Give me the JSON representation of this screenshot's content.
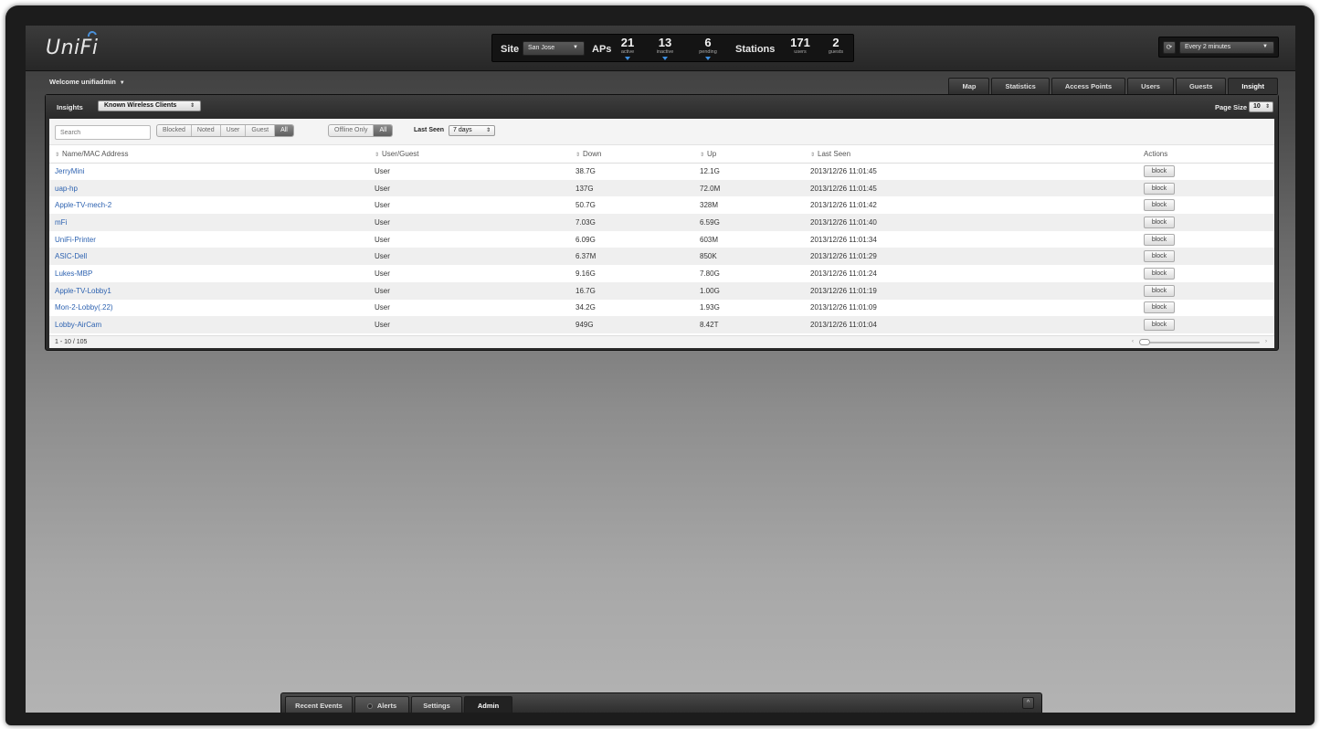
{
  "app": {
    "logo": "UniFi"
  },
  "header": {
    "site_label": "Site",
    "site_value": "San Jose",
    "aps_label": "APs",
    "aps": [
      {
        "num": "21",
        "sub": "active"
      },
      {
        "num": "13",
        "sub": "inactive"
      },
      {
        "num": "6",
        "sub": "pending"
      }
    ],
    "stations_label": "Stations",
    "stations": [
      {
        "num": "171",
        "sub": "users"
      },
      {
        "num": "2",
        "sub": "guests"
      }
    ],
    "refresh_value": "Every 2 minutes"
  },
  "welcome": "Welcome unifiadmin",
  "tabs": [
    "Map",
    "Statistics",
    "Access Points",
    "Users",
    "Guests",
    "Insight"
  ],
  "active_tab": "Insight",
  "insights": {
    "label": "Insights",
    "select_value": "Known Wireless Clients",
    "page_size_label": "Page Size",
    "page_size_value": "10"
  },
  "filters": {
    "search_placeholder": "Search",
    "type_buttons": [
      "Blocked",
      "Noted",
      "User",
      "Guest",
      "All"
    ],
    "type_active": "All",
    "offline_buttons": [
      "Offline Only",
      "All"
    ],
    "offline_active": "All",
    "last_seen_label": "Last Seen",
    "last_seen_value": "7 days"
  },
  "table": {
    "headers": [
      "Name/MAC Address",
      "User/Guest",
      "Down",
      "Up",
      "Last Seen",
      "Actions"
    ],
    "rows": [
      [
        "JerryMini",
        "User",
        "38.7G",
        "12.1G",
        "2013/12/26 11:01:45",
        "block"
      ],
      [
        "uap-hp",
        "User",
        "137G",
        "72.0M",
        "2013/12/26 11:01:45",
        "block"
      ],
      [
        "Apple-TV-mech-2",
        "User",
        "50.7G",
        "328M",
        "2013/12/26 11:01:42",
        "block"
      ],
      [
        "mFi",
        "User",
        "7.03G",
        "6.59G",
        "2013/12/26 11:01:40",
        "block"
      ],
      [
        "UniFi-Printer",
        "User",
        "6.09G",
        "603M",
        "2013/12/26 11:01:34",
        "block"
      ],
      [
        "ASIC-Dell",
        "User",
        "6.37M",
        "850K",
        "2013/12/26 11:01:29",
        "block"
      ],
      [
        "Lukes-MBP",
        "User",
        "9.16G",
        "7.80G",
        "2013/12/26 11:01:24",
        "block"
      ],
      [
        "Apple-TV-Lobby1",
        "User",
        "16.7G",
        "1.00G",
        "2013/12/26 11:01:19",
        "block"
      ],
      [
        "Mon-2-Lobby(.22)",
        "User",
        "34.2G",
        "1.93G",
        "2013/12/26 11:01:09",
        "block"
      ],
      [
        "Lobby-AirCam",
        "User",
        "949G",
        "8.42T",
        "2013/12/26 11:01:04",
        "block"
      ]
    ],
    "pagination": "1 - 10 / 105"
  },
  "bottom_tabs": [
    "Recent Events",
    "Alerts",
    "Settings",
    "Admin"
  ],
  "bottom_active": "Admin",
  "colors": {
    "link": "#2d62b0",
    "accent": "#3d8fe0"
  }
}
